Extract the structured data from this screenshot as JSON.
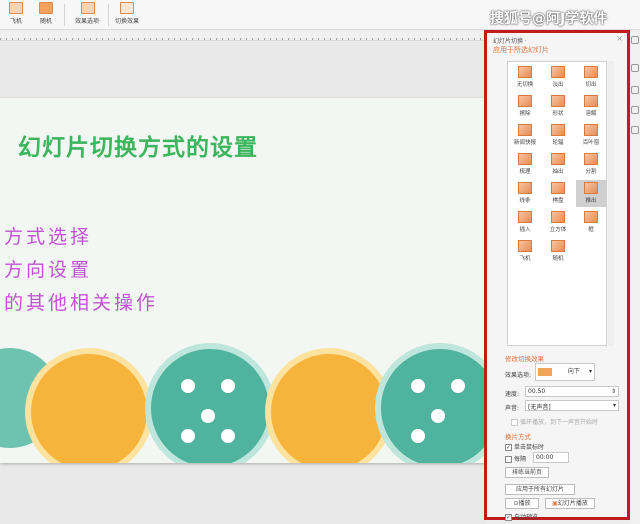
{
  "toolbar": {
    "buttons": [
      {
        "label": "飞机"
      },
      {
        "label": "随机"
      },
      {
        "label": "效果选项·"
      },
      {
        "label": "切换效果"
      }
    ]
  },
  "watermark": "搜狐号@阿J学软件",
  "slide": {
    "title": "幻灯片切换方式的设置",
    "lines": [
      "方式选择",
      "方向设置",
      "的其他相关操作"
    ]
  },
  "pane": {
    "header": "幻灯片切换 ·",
    "close": "×",
    "apply_heading": "应用于所选幻灯片",
    "transitions": [
      "无切换",
      "淡出",
      "切出",
      "擦除",
      "形状",
      "溶解",
      "新闻快报",
      "轮辐",
      "百叶窗",
      "梳理",
      "抽出",
      "分割",
      "线条",
      "棋盘",
      "推出",
      "插入",
      "立方体",
      "框",
      "飞机",
      "随机"
    ],
    "selected_transition": "推出",
    "modify_heading": "修改切换效果",
    "effect_label": "效果选项:",
    "effect_value": "向下",
    "speed_label": "速度:",
    "speed_value": "00.50",
    "sound_label": "声音:",
    "sound_value": "[无声音]",
    "loop_label": "循环播放，到下一声音开始时",
    "advance_heading": "换片方式",
    "on_click_label": "单击鼠标时",
    "every_label": "每隔",
    "every_value": "00:00",
    "rearrange_label": "排练当前页",
    "apply_all_label": "应用于所有幻灯片",
    "play_label": "播放",
    "slideshow_label": "幻灯片播放",
    "autopreview_label": "自动预览"
  },
  "colors": {
    "accent_orange": "#e0723a",
    "highlight_red": "#c11b1b",
    "title_green": "#3cb55c",
    "text_purple": "#c452d6"
  }
}
